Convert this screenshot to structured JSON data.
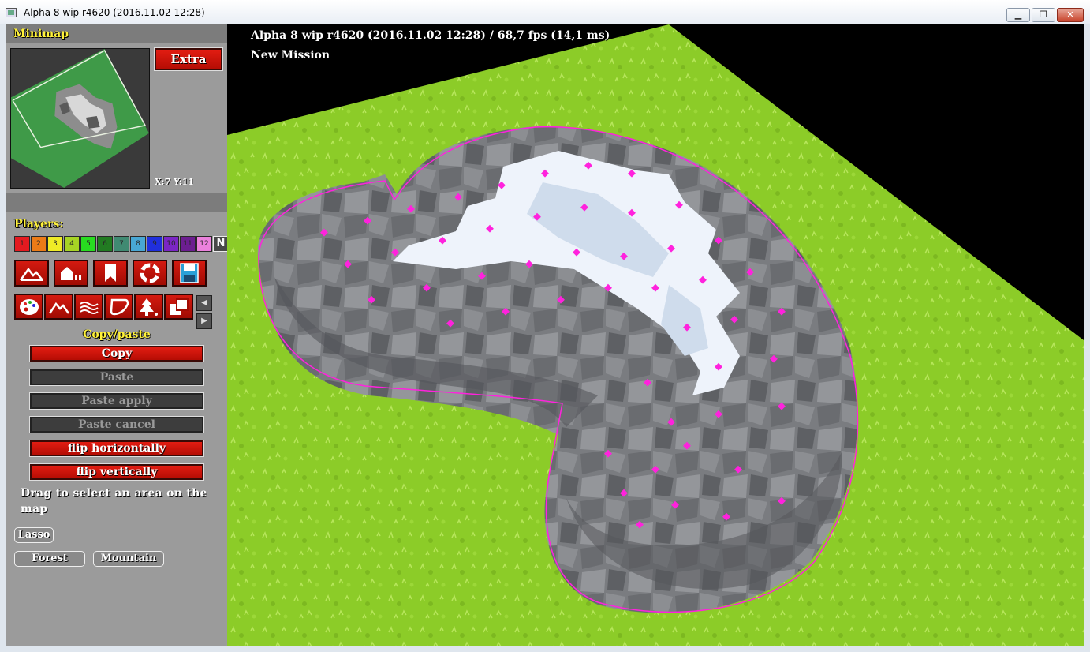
{
  "window": {
    "title": "Alpha 8 wip r4620 (2016.11.02 12:28)",
    "minimize": "▁",
    "maximize": "❐",
    "close": "✕"
  },
  "minimap": {
    "title": "Minimap",
    "coords": "X:7 Y:11",
    "extra_label": "Extra"
  },
  "players": {
    "label": "Players:",
    "items": [
      {
        "label": "1",
        "color": "#e8141a"
      },
      {
        "label": "2",
        "color": "#f07a10"
      },
      {
        "label": "3",
        "color": "#f4f020"
      },
      {
        "label": "4",
        "color": "#a8d81e"
      },
      {
        "label": "5",
        "color": "#22e01a"
      },
      {
        "label": "6",
        "color": "#1c7a1c"
      },
      {
        "label": "7",
        "color": "#3c8a70"
      },
      {
        "label": "8",
        "color": "#44a8d8"
      },
      {
        "label": "9",
        "color": "#1a2ae0"
      },
      {
        "label": "10",
        "color": "#7a20c8"
      },
      {
        "label": "11",
        "color": "#6a1890"
      },
      {
        "label": "12",
        "color": "#f080e0"
      },
      {
        "label": "N",
        "color": "#444444"
      }
    ]
  },
  "toolbar_row1": [
    "terrain-icon",
    "houses-icon",
    "bookmark-icon",
    "lifebuoy-icon",
    "save-icon"
  ],
  "toolbar_row2": [
    "palette-icon",
    "heights-icon",
    "water-icon",
    "shape-icon",
    "tree-icon",
    "copy-icon"
  ],
  "copy_paste": {
    "title": "Copy/paste",
    "copy": "Copy",
    "paste": "Paste",
    "paste_apply": "Paste apply",
    "paste_cancel": "Paste cancel",
    "flip_h": "flip horizontally",
    "flip_v": "flip vertically",
    "hint": "Drag to select an area on the map",
    "lasso": "Lasso",
    "forest": "Forest",
    "mountain": "Mountain"
  },
  "hud": {
    "fps_line": "Alpha 8 wip r4620 (2016.11.02 12:28) / 68,7 fps (14,1 ms)",
    "mission": "New Mission"
  },
  "colors": {
    "grass": "#8ccc28",
    "selection": "#ff22dd",
    "button_red": "#c8120a",
    "label_gold": "#fff23a"
  }
}
